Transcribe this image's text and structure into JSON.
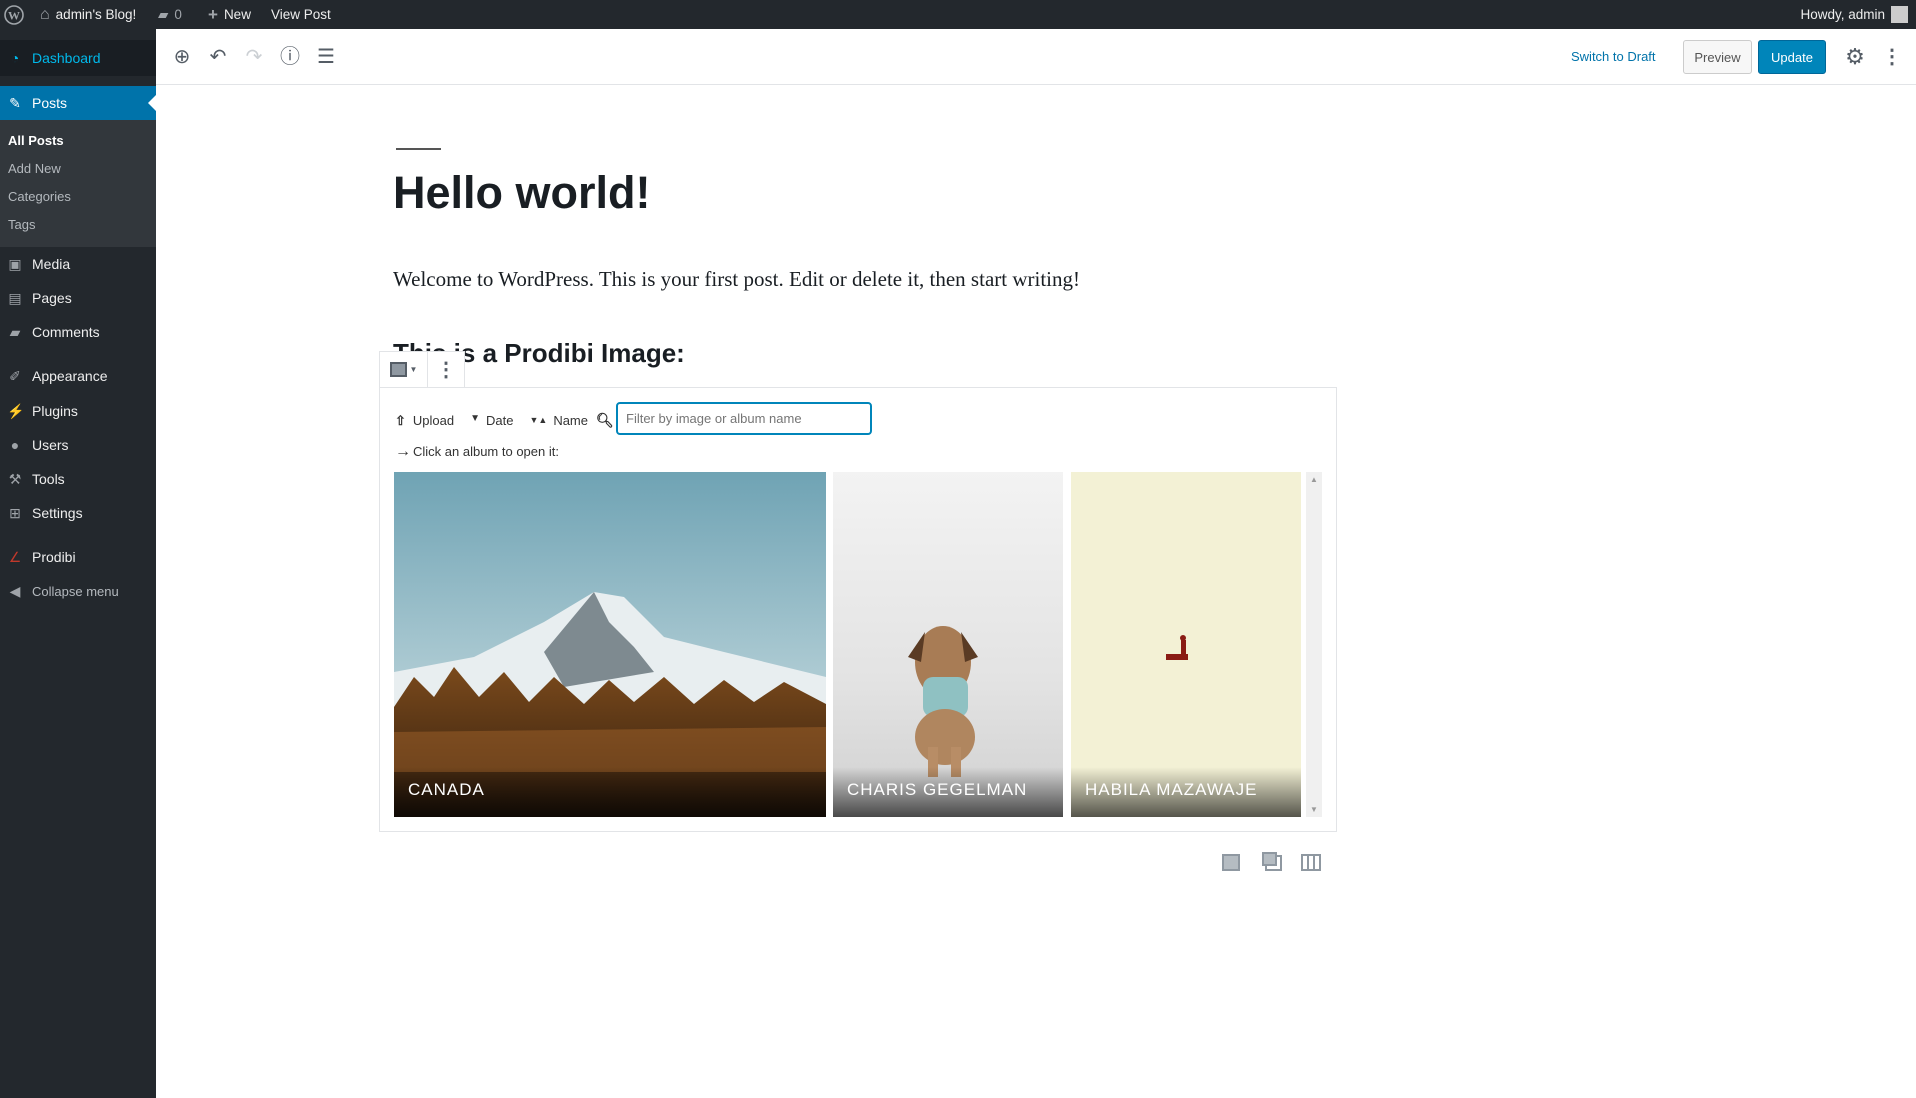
{
  "admin_bar": {
    "site_name": "admin's Blog!",
    "comments_count": "0",
    "new_label": "New",
    "view_post_label": "View Post",
    "howdy": "Howdy, admin"
  },
  "sidebar": {
    "dashboard": "Dashboard",
    "posts": "Posts",
    "posts_submenu": [
      "All Posts",
      "Add New",
      "Categories",
      "Tags"
    ],
    "items": [
      "Media",
      "Pages",
      "Comments",
      "Appearance",
      "Plugins",
      "Users",
      "Tools",
      "Settings",
      "Prodibi"
    ],
    "collapse": "Collapse menu"
  },
  "header": {
    "switch_to_draft": "Switch to Draft",
    "preview": "Preview",
    "update": "Update"
  },
  "post": {
    "title": "Hello world!",
    "paragraph": "Welcome to WordPress. This is your first post. Edit or delete it, then start writing!",
    "heading": "This is a Prodibi Image:"
  },
  "prodibi": {
    "upload": "Upload",
    "date": "Date",
    "name": "Name",
    "filter_placeholder": "Filter by image or album name",
    "hint": "Click an album to open it:",
    "albums": [
      "CANADA",
      "CHARIS GEGELMAN",
      "HABILA MAZAWAJE"
    ]
  },
  "colors": {
    "accent": "#0085ba",
    "admin_bar": "#23282d",
    "active_menu": "#0073aa",
    "link": "#0073aa"
  }
}
